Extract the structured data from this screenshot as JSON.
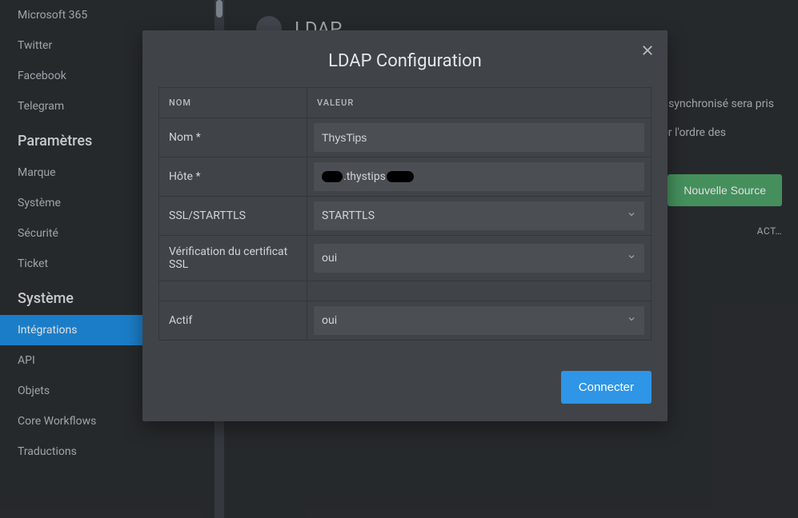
{
  "sidebar": {
    "groups": [
      {
        "items": [
          {
            "label": "Microsoft 365"
          },
          {
            "label": "Twitter"
          },
          {
            "label": "Facebook"
          },
          {
            "label": "Telegram"
          }
        ]
      },
      {
        "heading": "Paramètres",
        "items": [
          {
            "label": "Marque"
          },
          {
            "label": "Système"
          },
          {
            "label": "Sécurité"
          },
          {
            "label": "Ticket"
          }
        ]
      },
      {
        "heading": "Système",
        "items": [
          {
            "label": "Intégrations",
            "active": true
          },
          {
            "label": "API"
          },
          {
            "label": "Objets"
          },
          {
            "label": "Core Workflows"
          },
          {
            "label": "Traductions"
          }
        ]
      }
    ]
  },
  "page": {
    "title": "LDAP",
    "hint1": "synchronisé sera pris",
    "hint2": "encer l'ordre des",
    "new_source": "Nouvelle Source",
    "act": "ACT…"
  },
  "modal": {
    "title": "LDAP Configuration",
    "col_name": "NOM",
    "col_value": "VALEUR",
    "rows": {
      "name_label": "Nom *",
      "name_value": "ThysTips",
      "host_label": "Hôte *",
      "host_value": ".thystips",
      "ssl_label": "SSL/STARTTLS",
      "ssl_value": "STARTTLS",
      "cert_label": "Vérification du certificat SSL",
      "cert_value": "oui",
      "active_label": "Actif",
      "active_value": "oui"
    },
    "connect": "Connecter"
  }
}
